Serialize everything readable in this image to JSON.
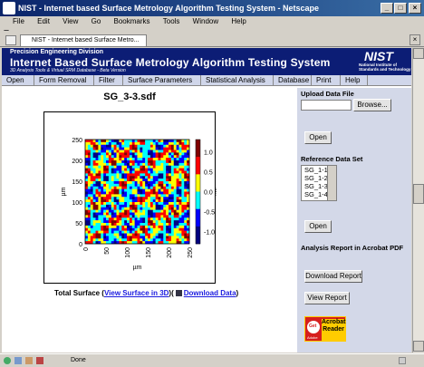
{
  "window": {
    "title": "NIST - Internet based Surface Metrology Algorithm Testing System - Netscape"
  },
  "menu": [
    "File",
    "Edit",
    "View",
    "Go",
    "Bookmarks",
    "Tools",
    "Window",
    "Help"
  ],
  "tab": {
    "label": "NIST - Internet based Surface Metro..."
  },
  "banner": {
    "division": "Precision Engineering Division",
    "title": "Internet Based Surface Metrology Algorithm Testing System",
    "subtitle": "3D Analysis Tools & Virtual SRM Database - Beta Version",
    "logo": "NIST",
    "institute": "National Institute of Standards and Technology"
  },
  "nav": [
    "Open",
    "Form Removal",
    "Filter",
    "Surface Parameters",
    "Statistical Analysis",
    "Database",
    "Print",
    "Help"
  ],
  "plot": {
    "title": "SG_3-3.sdf"
  },
  "chart_data": {
    "type": "heatmap",
    "title": "SG_3-3.sdf",
    "xlabel": "µm",
    "ylabel": "µm",
    "xlim": [
      0,
      250
    ],
    "ylim": [
      0,
      250
    ],
    "xticks": [
      "0",
      "50",
      "100",
      "150",
      "200",
      "250"
    ],
    "yticks": [
      "0",
      "50",
      "100",
      "150",
      "200",
      "250"
    ],
    "colorbar_ticks": [
      "1.0",
      "0.5",
      "0.0",
      "-0.5",
      "-1.0"
    ],
    "colorbar_unit": "µm",
    "zlim": [
      -1.3,
      1.3
    ],
    "colormap": [
      "#000080",
      "#0000ff",
      "#00ffff",
      "#ffff00",
      "#ff0000",
      "#800000"
    ]
  },
  "caption": {
    "prefix": "Total Surface (",
    "link1": "View Surface in 3D",
    "mid": ")(",
    "link2": "Download Data",
    "suffix": ")"
  },
  "sidebar": {
    "upload_title": "Upload Data File",
    "browse": "Browse...",
    "open1": "Open",
    "ref_title": "Reference Data Set",
    "ref_items": [
      "SG_1-1",
      "SG_1-2",
      "SG_1-3",
      "SG_1-4"
    ],
    "open2": "Open",
    "report_title": "Analysis Report in Acrobat PDF",
    "download": "Download Report",
    "view": "View Report",
    "acrobat_get": "Get",
    "acrobat_name": "Acrobat Reader",
    "acrobat_brand": "Adobe"
  },
  "status": {
    "text": "Done"
  },
  "colors": {
    "banner": "#0c1d75",
    "nav": "#d0d6ea",
    "sidebar": "#d3d8e8",
    "link": "#1a1adf"
  }
}
